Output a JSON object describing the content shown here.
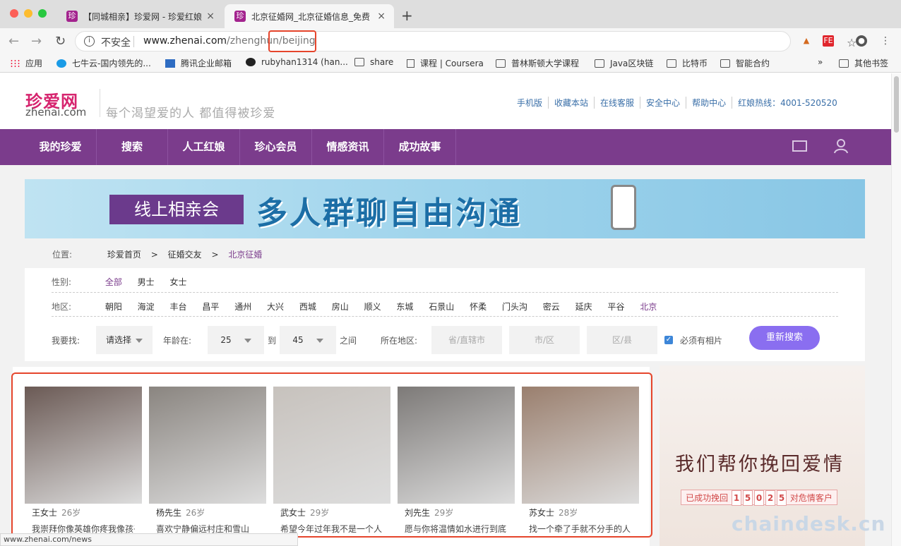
{
  "browser": {
    "tabs": [
      {
        "title": "【同城相亲】珍爱网 - 珍爱红娘",
        "close": "×"
      },
      {
        "title": "北京征婚网_北京征婚信息_免费",
        "close": "×"
      }
    ],
    "favicon_text": "珍",
    "new_tab": "+",
    "security_label": "不安全",
    "url_host": "www.zhenai.com",
    "url_path": "/zhenghun/beijing",
    "ext_badge": "FE",
    "bookmarks": [
      "应用",
      "七牛云-国内领先的...",
      "腾讯企业邮箱",
      "rubyhan1314 (han...",
      "share",
      "课程 | Coursera",
      "普林斯顿大学课程",
      "Java区块链",
      "比特币",
      "智能合约",
      "»",
      "其他书签"
    ],
    "status_url": "www.zhenai.com/news"
  },
  "header": {
    "logo_cn": "珍爱网",
    "logo_en": "zhenai.com",
    "slogan": "每个渴望爱的人  都值得被珍爱",
    "links": [
      "手机版",
      "收藏本站",
      "在线客服",
      "安全中心",
      "帮助中心",
      "红娘热线：4001-520520"
    ]
  },
  "nav": [
    "我的珍爱",
    "搜索",
    "人工红娘",
    "珍心会员",
    "情感资讯",
    "成功故事"
  ],
  "banner": {
    "tag": "线上相亲会",
    "headline": "多人群聊自由沟通"
  },
  "breadcrumb": {
    "label": "位置:",
    "items": [
      "珍爱首页",
      ">",
      "征婚交友",
      ">",
      "北京征婚"
    ]
  },
  "filters": {
    "gender_label": "性别:",
    "genders": [
      "全部",
      "男士",
      "女士"
    ],
    "region_label": "地区:",
    "regions": [
      "朝阳",
      "海淀",
      "丰台",
      "昌平",
      "通州",
      "大兴",
      "西城",
      "房山",
      "顺义",
      "东城",
      "石景山",
      "怀柔",
      "门头沟",
      "密云",
      "延庆",
      "平谷",
      "北京"
    ],
    "find_label": "我要找:",
    "find_value": "请选择",
    "age_label": "年龄在:",
    "age_from": "25",
    "age_to_label": "到",
    "age_to": "45",
    "between": "之间",
    "location_label": "所在地区:",
    "province_ph": "省/直辖市",
    "city_ph": "市/区",
    "district_ph": "区/县",
    "photo_required": "必须有相片",
    "research_button": "重新搜索"
  },
  "profiles": [
    {
      "name": "王女士",
      "age": "26岁",
      "desc": "我崇拜你像英雄你疼我像孩子",
      "color": "#6b5a55"
    },
    {
      "name": "杨先生",
      "age": "26岁",
      "desc": "喜欢宁静偏远村庄和雪山",
      "color": "#8a8580"
    },
    {
      "name": "武女士",
      "age": "29岁",
      "desc": "希望今年过年我不是一个人",
      "color": "#c7c2bd"
    },
    {
      "name": "刘先生",
      "age": "29岁",
      "desc": "愿与你将温情如水进行到底",
      "color": "#7d7a78"
    },
    {
      "name": "苏女士",
      "age": "28岁",
      "desc": "找一个牵了手就不分手的人",
      "color": "#9a7f6e"
    }
  ],
  "side_ad": {
    "title": "我们帮你挽回爱情",
    "prefix": "已成功挽回",
    "digits": [
      "1",
      "5",
      "0",
      "2",
      "5"
    ],
    "suffix": "对危情客户"
  },
  "watermark": "chaindesk.cn"
}
